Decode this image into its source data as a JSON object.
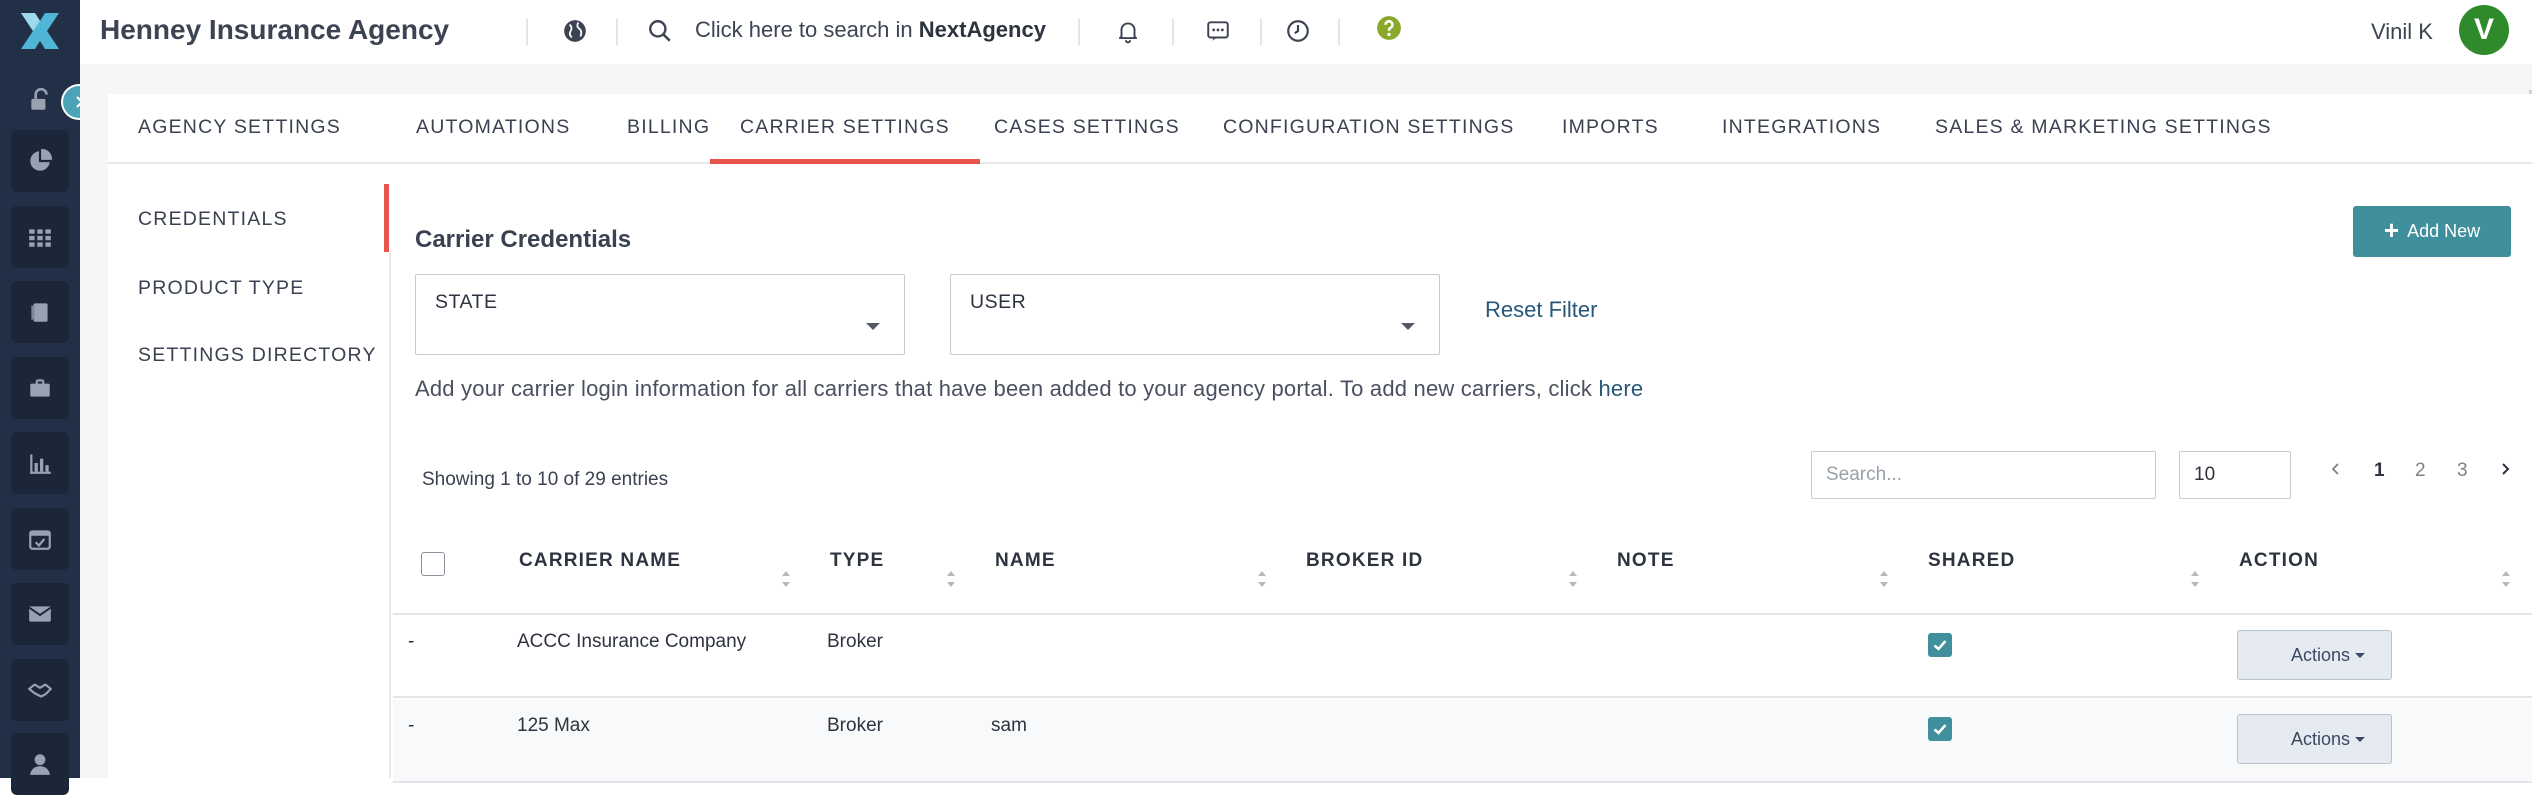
{
  "app": {
    "agency_name": "Henney Insurance Agency",
    "search_prefix": "Click here to search in",
    "search_brand": "NextAgency",
    "user_name": "Vinil K",
    "avatar_letter": "V",
    "colors": {
      "accent": "#e8544c",
      "primary_button": "#3f8f9c",
      "rail": "#223047",
      "avatar": "#2f8a2b",
      "link": "#27587a"
    }
  },
  "rail": {
    "icons": [
      "logo-icon",
      "unlock-icon",
      "pie-chart-icon",
      "grid-icon",
      "book-icon",
      "briefcase-icon",
      "bar-chart-icon",
      "calendar-icon",
      "mail-icon",
      "handshake-icon",
      "user-icon"
    ]
  },
  "tabs": [
    {
      "label": "AGENCY SETTINGS"
    },
    {
      "label": "AUTOMATIONS"
    },
    {
      "label": "BILLING"
    },
    {
      "label": "CARRIER SETTINGS",
      "active": true
    },
    {
      "label": "CASES SETTINGS"
    },
    {
      "label": "CONFIGURATION SETTINGS"
    },
    {
      "label": "IMPORTS"
    },
    {
      "label": "INTEGRATIONS"
    },
    {
      "label": "SALES & MARKETING SETTINGS"
    }
  ],
  "subnav": [
    {
      "label": "CREDENTIALS",
      "active": true
    },
    {
      "label": "PRODUCT TYPE"
    },
    {
      "label": "SETTINGS DIRECTORY"
    }
  ],
  "section": {
    "title": "Carrier Credentials",
    "add_button": "Add New",
    "filters": {
      "state_label": "STATE",
      "user_label": "USER",
      "reset": "Reset Filter"
    },
    "info_text": "Add your carrier login information for all carriers that have been added to your agency portal. To add new carriers, click",
    "info_link": "here"
  },
  "table_controls": {
    "showing": "Showing 1 to 10 of 29 entries",
    "search_placeholder": "Search...",
    "page_size": "10",
    "pages": [
      "1",
      "2",
      "3"
    ],
    "current_page": "1"
  },
  "table": {
    "columns": [
      "CARRIER NAME",
      "TYPE",
      "NAME",
      "BROKER ID",
      "NOTE",
      "SHARED",
      "ACTION"
    ],
    "rows": [
      {
        "select": "-",
        "carrier_name": "ACCC Insurance Company",
        "type": "Broker",
        "name": "",
        "broker_id": "",
        "note": "",
        "shared": true,
        "action": "Actions"
      },
      {
        "select": "-",
        "carrier_name": "125 Max",
        "type": "Broker",
        "name": "sam",
        "broker_id": "",
        "note": "",
        "shared": true,
        "action": "Actions"
      }
    ]
  }
}
